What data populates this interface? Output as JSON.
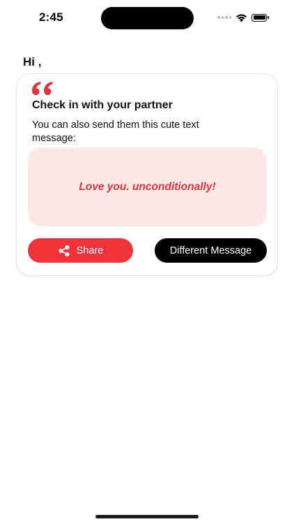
{
  "status_bar": {
    "time": "2:45",
    "icons": [
      "cellular-signal-icon",
      "wifi-icon",
      "battery-icon"
    ]
  },
  "greeting": {
    "text": "Hi ,"
  },
  "card": {
    "icon": "quote-icon",
    "title": "Check in with your partner",
    "subtitle": "You can also send them this cute text message:",
    "message": "Love you. unconditionally!",
    "share_button": {
      "label": "Share",
      "icon": "share-icon"
    },
    "different_button": {
      "label": "Different Message"
    }
  },
  "colors": {
    "accent": "#f0333a",
    "message_background": "#fde8e8",
    "message_text": "#e0333a",
    "secondary_button": "#000000"
  }
}
